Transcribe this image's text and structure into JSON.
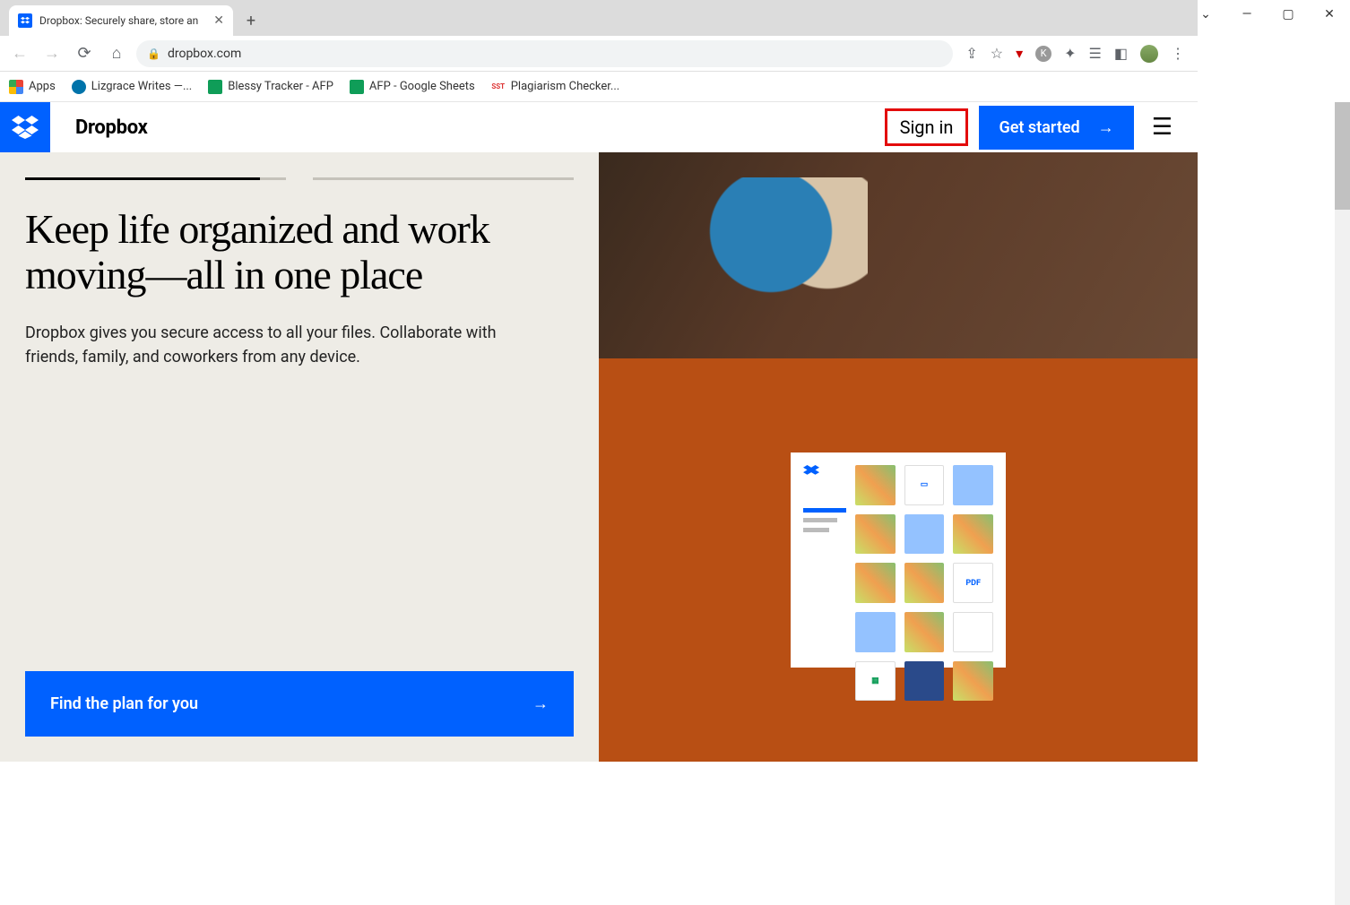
{
  "browser": {
    "tab_title": "Dropbox: Securely share, store an",
    "url": "dropbox.com",
    "bookmarks": [
      {
        "label": "Apps",
        "icon": "apps"
      },
      {
        "label": "Lizgrace Writes —...",
        "icon": "wp"
      },
      {
        "label": "Blessy Tracker - AFP",
        "icon": "sheets"
      },
      {
        "label": "AFP - Google Sheets",
        "icon": "sheets"
      },
      {
        "label": "Plagiarism Checker...",
        "icon": "sst"
      }
    ]
  },
  "header": {
    "brand": "Dropbox",
    "signin": "Sign in",
    "get_started": "Get started"
  },
  "hero": {
    "title": "Keep life organized and work moving—all in one place",
    "subtitle": "Dropbox gives you secure access to all your files. Collaborate with friends, family, and coworkers from any device.",
    "cta": "Find the plan for you"
  },
  "files_card": {
    "pdf_label": "PDF"
  }
}
